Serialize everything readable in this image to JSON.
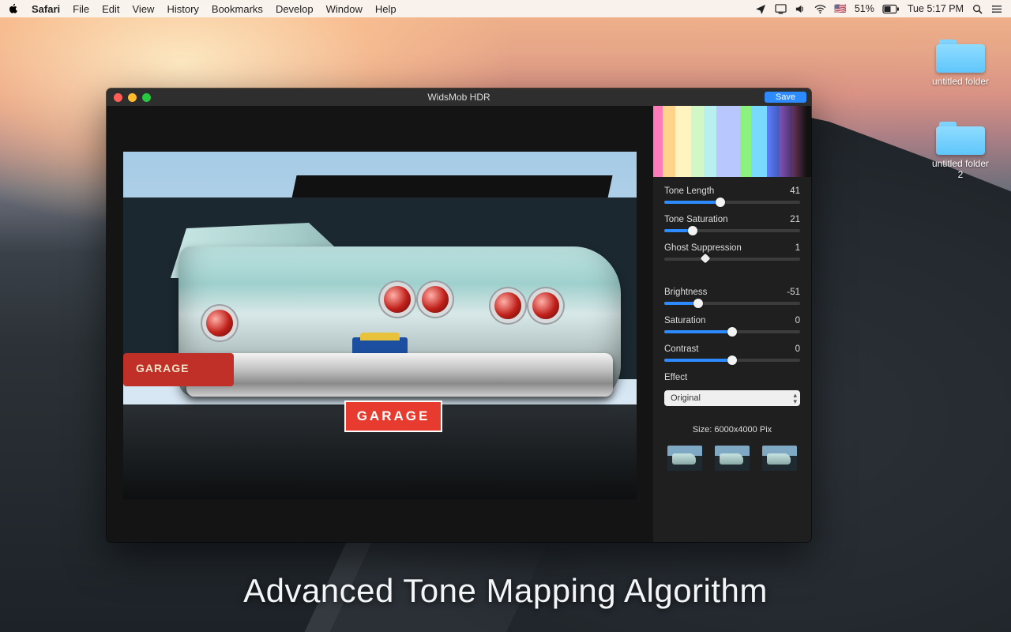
{
  "menubar": {
    "app": "Safari",
    "items": [
      "File",
      "Edit",
      "View",
      "History",
      "Bookmarks",
      "Develop",
      "Window",
      "Help"
    ],
    "battery_pct": "51%",
    "clock": "Tue 5:17 PM",
    "flag": "🇺🇸"
  },
  "desktop": {
    "folders": [
      {
        "label": "untitled folder"
      },
      {
        "label": "untitled folder 2"
      }
    ]
  },
  "window": {
    "title": "WidsMob HDR",
    "save_label": "Save"
  },
  "panel": {
    "sliders": [
      {
        "label": "Tone Length",
        "value": "41",
        "pct": 41,
        "offset": 50
      },
      {
        "label": "Tone Saturation",
        "value": "21",
        "pct": 21,
        "offset": 50
      },
      {
        "label": "Ghost Suppression",
        "value": "1",
        "pct": 30,
        "offset": 0,
        "ghost": true
      },
      {
        "label": "Brightness",
        "value": "-51",
        "pct": 25,
        "offset": 50
      },
      {
        "label": "Saturation",
        "value": "0",
        "pct": 50,
        "offset": 50
      },
      {
        "label": "Contrast",
        "value": "0",
        "pct": 50,
        "offset": 50
      }
    ],
    "effect_label": "Effect",
    "effect_value": "Original",
    "size_label": "Size: 6000x4000 Pix"
  },
  "caption": "Advanced Tone Mapping Algorithm"
}
